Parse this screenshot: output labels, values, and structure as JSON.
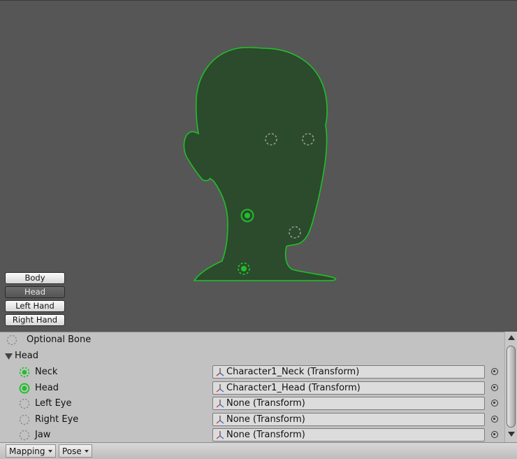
{
  "body_parts": {
    "items": [
      {
        "label": "Body"
      },
      {
        "label": "Head"
      },
      {
        "label": "Left Hand"
      },
      {
        "label": "Right Hand"
      }
    ],
    "active": "Head"
  },
  "panel": {
    "legend_label": "Optional Bone",
    "group_label": "Head",
    "bones": [
      {
        "label": "Neck",
        "value": "Character1_Neck (Transform)",
        "state": "assigned-optional"
      },
      {
        "label": "Head",
        "value": "Character1_Head (Transform)",
        "state": "assigned-required"
      },
      {
        "label": "Left Eye",
        "value": "None (Transform)",
        "state": "empty-optional"
      },
      {
        "label": "Right Eye",
        "value": "None (Transform)",
        "state": "empty-optional"
      },
      {
        "label": "Jaw",
        "value": "None (Transform)",
        "state": "empty-optional"
      }
    ]
  },
  "toolbar": {
    "mapping_label": "Mapping",
    "pose_label": "Pose"
  },
  "colors": {
    "accent_green": "#1fbf2a",
    "head_fill": "#2c4a2c",
    "viewport_bg": "#565656",
    "panel_bg": "#c2c2c2"
  }
}
